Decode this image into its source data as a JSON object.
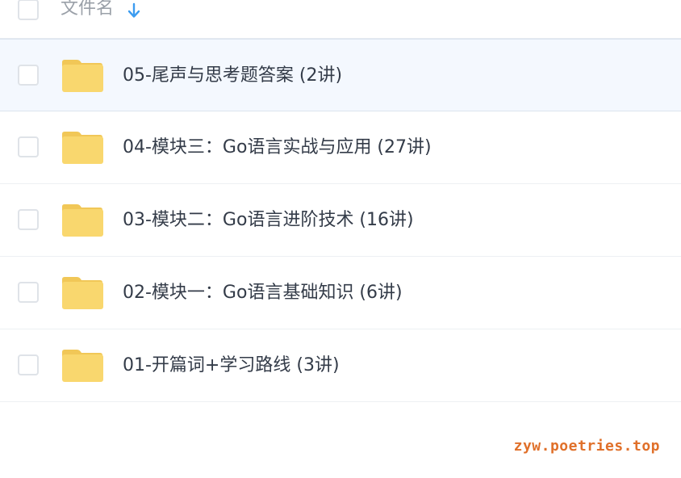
{
  "header": {
    "column_label": "文件名",
    "sort_icon": "arrow-down-icon",
    "sort_icon_color": "#3c9cf0"
  },
  "rows": [
    {
      "label": "05-尾声与思考题答案 (2讲)",
      "selected": true,
      "icon": "folder-icon"
    },
    {
      "label": "04-模块三：Go语言实战与应用 (27讲)",
      "selected": false,
      "icon": "folder-icon"
    },
    {
      "label": "03-模块二：Go语言进阶技术 (16讲)",
      "selected": false,
      "icon": "folder-icon"
    },
    {
      "label": "02-模块一：Go语言基础知识 (6讲)",
      "selected": false,
      "icon": "folder-icon"
    },
    {
      "label": "01-开篇词+学习路线 (3讲)",
      "selected": false,
      "icon": "folder-icon"
    }
  ],
  "colors": {
    "folder": "#f9d76e",
    "folder_tab": "#f1c757",
    "selected_row_bg": "#f4f8fe",
    "text": "#333b48",
    "watermark": "#e0702a"
  },
  "watermark": "zyw.poetries.top"
}
